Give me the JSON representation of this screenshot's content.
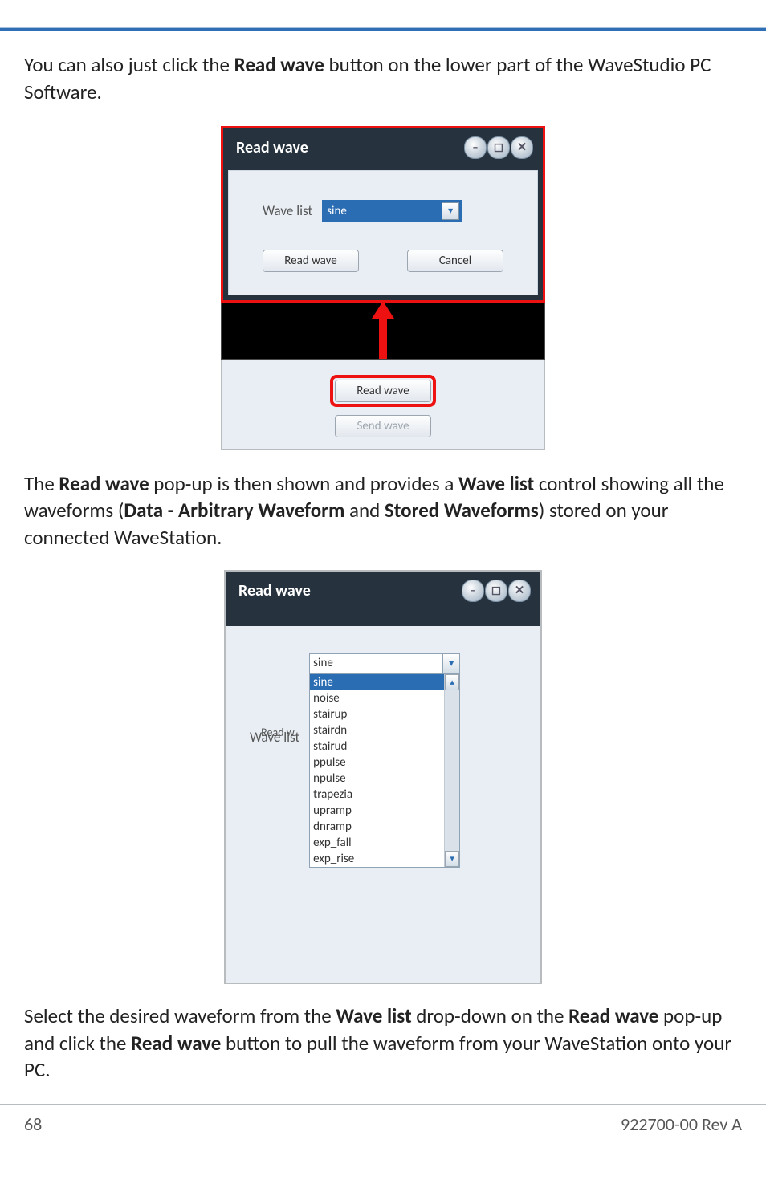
{
  "intro": {
    "p1_a": "You can also just click the ",
    "p1_b": "Read wave",
    "p1_c": " button on the lower part of the WaveStudio PC Software."
  },
  "dialog1": {
    "title": "Read wave",
    "field_label": "Wave list",
    "selected": "sine",
    "read_btn": "Read wave",
    "cancel_btn": "Cancel"
  },
  "lower_buttons": {
    "read": "Read wave",
    "send": "Send wave"
  },
  "mid_para": {
    "a": "The ",
    "b": "Read wave",
    "c": " pop-up is then shown and provides a ",
    "d": "Wave list",
    "e": " control showing all the waveforms (",
    "f": "Data - Arbitrary Waveform",
    "g": " and ",
    "h": "Stored Waveforms",
    "i": ") stored on your connected WaveStation."
  },
  "dialog2": {
    "title": "Read wave",
    "field_label": "Wave list",
    "current": "sine",
    "read_hint": "Read w",
    "options": [
      "sine",
      "noise",
      "stairup",
      "stairdn",
      "stairud",
      "ppulse",
      "npulse",
      "trapezia",
      "upramp",
      "dnramp",
      "exp_fall",
      "exp_rise"
    ]
  },
  "final_para": {
    "a": "Select the desired waveform from the ",
    "b": "Wave list",
    "c": " drop-down on the ",
    "d": "Read wave",
    "e": " pop-up and click the ",
    "f": "Read wave",
    "g": " button to pull the waveform from your WaveStation onto your PC."
  },
  "footer": {
    "left": "68",
    "right": "922700-00 Rev A"
  }
}
